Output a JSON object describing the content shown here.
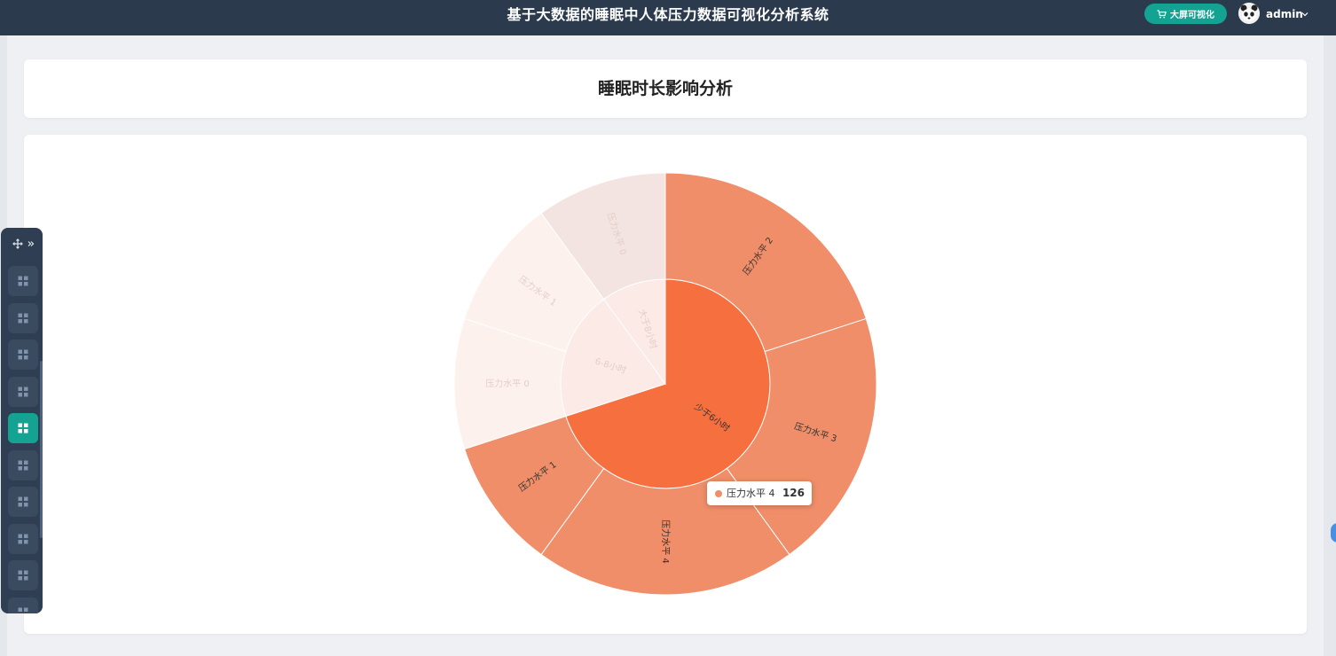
{
  "header": {
    "app_title": "基于大数据的睡眠中人体压力数据可视化分析系统",
    "bigscreen_label": "大屏可视化",
    "user_name": "admin"
  },
  "page": {
    "title": "睡眠时长影响分析"
  },
  "tooltip": {
    "label": "压力水平 4",
    "value": "126",
    "color": "#ef8e68"
  },
  "toolbar": {
    "button_count": 10,
    "active_index": 4
  },
  "chart_data": {
    "type": "sunburst",
    "highlighted": "少于6小时",
    "colors": {
      "inner_active": "#f6703f",
      "outer_active": "#ef8e68",
      "inner_dim": "#fbeae6",
      "outer_dim_a": "#f3e4e1",
      "outer_dim_b": "#fdf1ee",
      "label_active": "#333333",
      "label_dim": "#e4cdc8"
    },
    "groups": [
      {
        "name": "少于6小时",
        "children": [
          {
            "name": "压力水平 2",
            "value": 126
          },
          {
            "name": "压力水平 3",
            "value": 126
          },
          {
            "name": "压力水平 4",
            "value": 126
          },
          {
            "name": "压力水平 1",
            "value": 63
          }
        ]
      },
      {
        "name": "6-8小时",
        "children": [
          {
            "name": "压力水平 0",
            "value": 63
          },
          {
            "name": "压力水平 1",
            "value": 63
          }
        ]
      },
      {
        "name": "大于8小时",
        "children": [
          {
            "name": "压力水平 0",
            "value": 63
          }
        ]
      }
    ]
  }
}
